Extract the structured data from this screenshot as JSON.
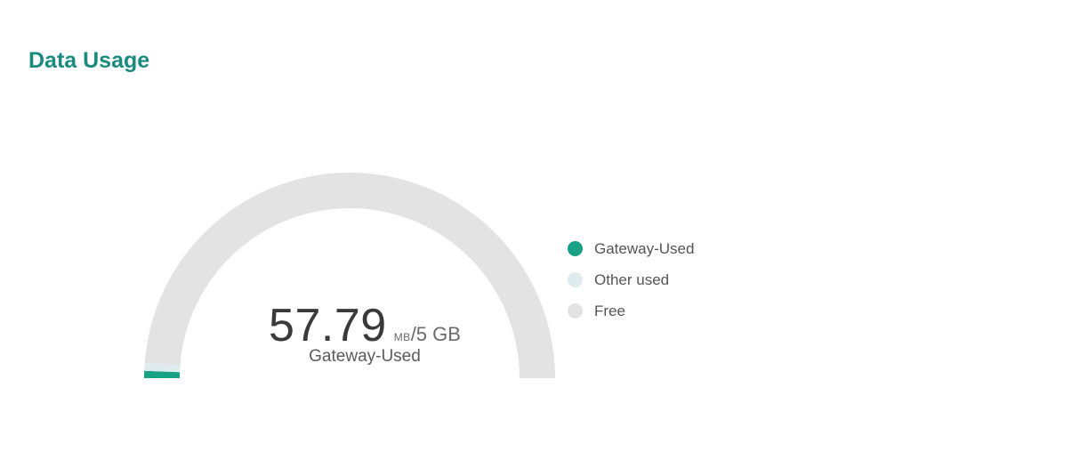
{
  "page": {
    "title": "Data Usage"
  },
  "colors": {
    "title": "#1b8a7e",
    "gateway_used": "#18a184",
    "other_used": "#dfecef",
    "free": "#e3e3e3"
  },
  "gauge": {
    "value": "57.79",
    "unit_small": "MB",
    "total": "/5 GB",
    "label": "Gateway-Used"
  },
  "chart_data": {
    "type": "pie",
    "variant": "half-donut gauge",
    "total": 5120,
    "units": "MB",
    "series": [
      {
        "name": "Gateway-Used",
        "value": 57.79,
        "color": "#18a184"
      },
      {
        "name": "Other used",
        "value": 64,
        "color": "#dfecef"
      },
      {
        "name": "Free",
        "value": 4998.21,
        "color": "#e3e3e3"
      }
    ],
    "legend": [
      {
        "label": "Gateway-Used",
        "color": "#18a184"
      },
      {
        "label": "Other used",
        "color": "#dfecef"
      },
      {
        "label": "Free",
        "color": "#e3e3e3"
      }
    ],
    "legend_position": "right"
  }
}
